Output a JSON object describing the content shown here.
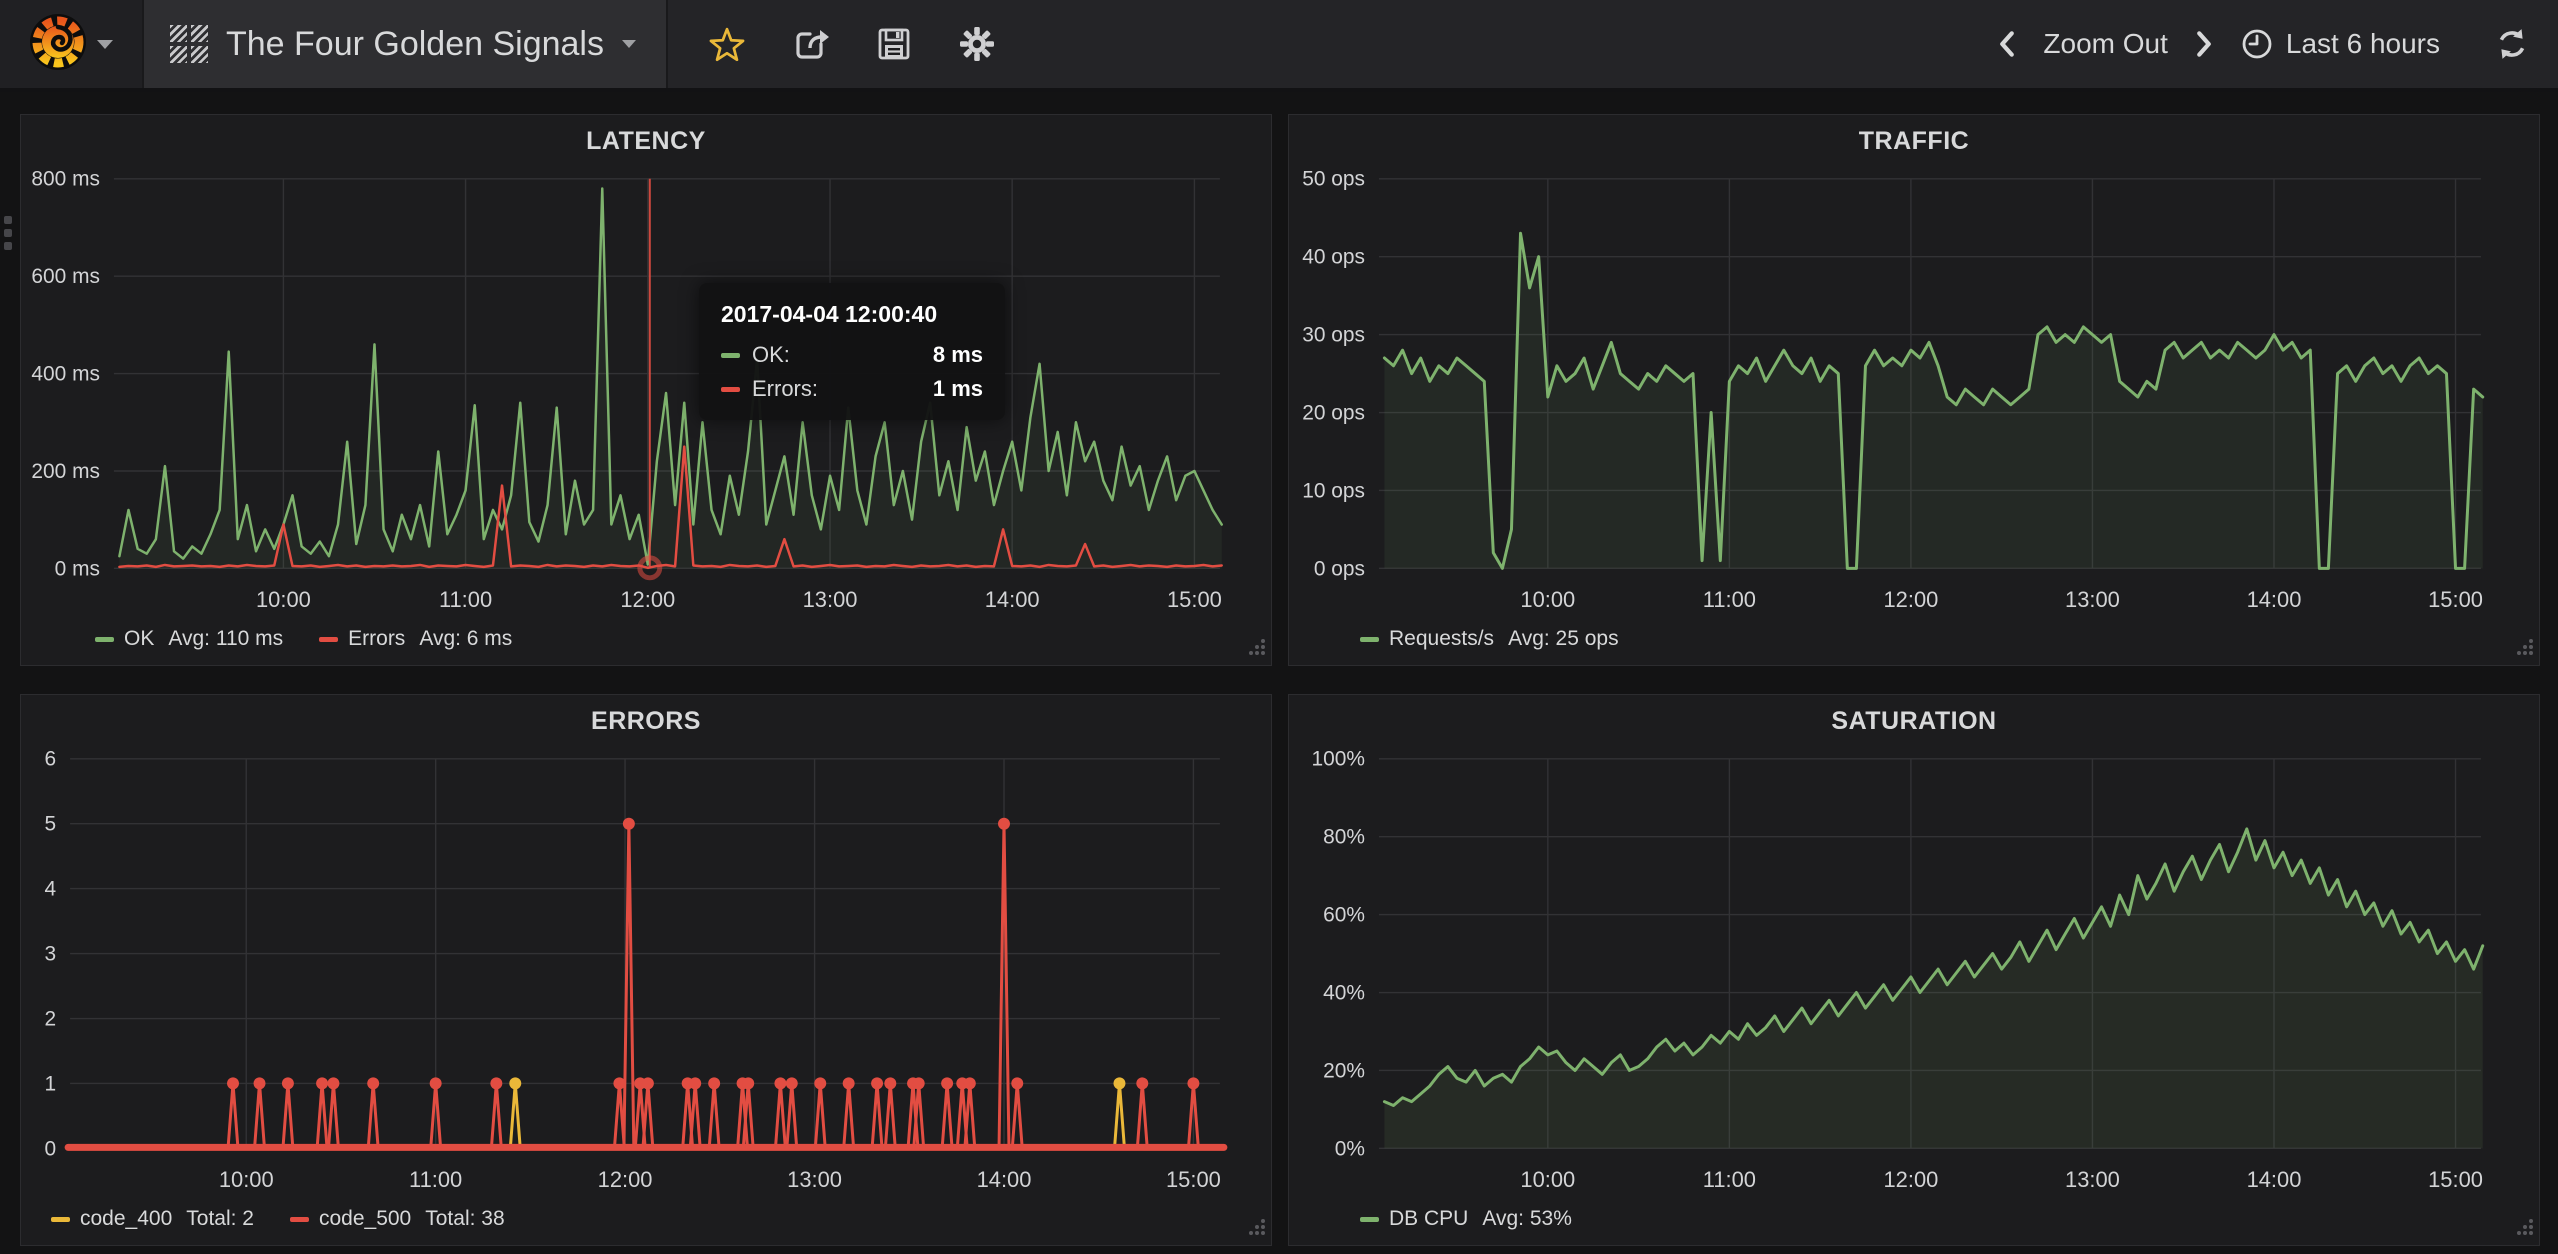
{
  "navbar": {
    "title": "The Four Golden Signals",
    "zoom_out_label": "Zoom Out",
    "time_range_label": "Last 6 hours"
  },
  "colors": {
    "green": "#7eb26d",
    "red": "#e24d42",
    "yellow": "#eab839",
    "star": "#eab839",
    "panel_bg": "#1c1c1e",
    "page_bg": "#131314",
    "navbar_bg": "#242427",
    "gridline": "#323235",
    "text": "#d8d9da"
  },
  "chart_data": [
    {
      "id": "latency",
      "type": "line",
      "title": "LATENCY",
      "xlabel": "",
      "ylabel": "",
      "xlim": [
        9.07,
        15.14
      ],
      "ylim": [
        0,
        800
      ],
      "grid": true,
      "legend_position": "bottom-left",
      "xticks": {
        "values": [
          10,
          11,
          12,
          13,
          14,
          15
        ],
        "labels": [
          "10:00",
          "11:00",
          "12:00",
          "13:00",
          "14:00",
          "15:00"
        ]
      },
      "yticks": {
        "values": [
          0,
          200,
          400,
          600,
          800
        ],
        "labels": [
          "0 ms",
          "200 ms",
          "400 ms",
          "600 ms",
          "800 ms"
        ]
      },
      "series": [
        {
          "name": "OK",
          "color": "#7eb26d",
          "width": 2.5,
          "fill": 0.08,
          "t0": 9.1,
          "dt": 0.05,
          "values": [
            25,
            120,
            40,
            30,
            60,
            210,
            35,
            20,
            45,
            30,
            70,
            120,
            445,
            60,
            130,
            35,
            80,
            40,
            90,
            150,
            45,
            30,
            55,
            25,
            90,
            260,
            50,
            130,
            460,
            80,
            35,
            110,
            60,
            130,
            45,
            240,
            70,
            110,
            160,
            335,
            60,
            120,
            80,
            150,
            340,
            95,
            55,
            130,
            330,
            70,
            180,
            90,
            120,
            780,
            90,
            150,
            60,
            110,
            8,
            220,
            360,
            130,
            340,
            90,
            300,
            120,
            70,
            190,
            110,
            240,
            430,
            90,
            160,
            230,
            110,
            300,
            150,
            80,
            190,
            120,
            330,
            160,
            90,
            230,
            300,
            130,
            200,
            100,
            260,
            340,
            150,
            220,
            120,
            290,
            180,
            240,
            130,
            200,
            260,
            160,
            310,
            420,
            200,
            280,
            150,
            300,
            220,
            260,
            180,
            140,
            250,
            170,
            210,
            120,
            180,
            230,
            140,
            190,
            200,
            160,
            120,
            90
          ]
        },
        {
          "name": "Errors",
          "color": "#e24d42",
          "width": 2.5,
          "fill": 0,
          "t0": 9.1,
          "dt": 0.05,
          "values": [
            3,
            5,
            4,
            6,
            3,
            7,
            4,
            5,
            6,
            4,
            5,
            3,
            6,
            4,
            7,
            5,
            4,
            6,
            90,
            5,
            4,
            6,
            3,
            5,
            7,
            4,
            6,
            3,
            5,
            4,
            6,
            4,
            5,
            7,
            3,
            6,
            5,
            4,
            7,
            5,
            3,
            6,
            170,
            4,
            6,
            5,
            3,
            7,
            4,
            6,
            5,
            3,
            6,
            4,
            7,
            5,
            4,
            6,
            1,
            5,
            7,
            4,
            250,
            6,
            4,
            5,
            3,
            7,
            5,
            4,
            6,
            3,
            5,
            60,
            4,
            6,
            3,
            5,
            7,
            4,
            5,
            6,
            3,
            5,
            4,
            7,
            5,
            3,
            6,
            4,
            5,
            7,
            4,
            6,
            3,
            5,
            4,
            80,
            5,
            4,
            6,
            3,
            7,
            5,
            4,
            6,
            50,
            4,
            6,
            3,
            5,
            7,
            4,
            6,
            5,
            3,
            6,
            4,
            5,
            7,
            4,
            6
          ]
        }
      ],
      "legend": [
        {
          "name": "OK",
          "stat": "Avg: 110 ms",
          "color": "#7eb26d"
        },
        {
          "name": "Errors",
          "stat": "Avg: 6 ms",
          "color": "#e24d42"
        }
      ],
      "crosshair": {
        "time": 12.011,
        "marker_value": 1,
        "color": "#e24d42"
      },
      "tooltip": {
        "time": "2017-04-04 12:00:40",
        "rows": [
          {
            "label": "OK:",
            "value": "8 ms",
            "color": "#7eb26d"
          },
          {
            "label": "Errors:",
            "value": "1 ms",
            "color": "#e24d42"
          }
        ]
      }
    },
    {
      "id": "traffic",
      "type": "line",
      "title": "TRAFFIC",
      "xlabel": "",
      "ylabel": "",
      "xlim": [
        9.07,
        15.14
      ],
      "ylim": [
        0,
        50
      ],
      "grid": true,
      "legend_position": "bottom-left",
      "xticks": {
        "values": [
          10,
          11,
          12,
          13,
          14,
          15
        ],
        "labels": [
          "10:00",
          "11:00",
          "12:00",
          "13:00",
          "14:00",
          "15:00"
        ]
      },
      "yticks": {
        "values": [
          0,
          10,
          20,
          30,
          40,
          50
        ],
        "labels": [
          "0 ops",
          "10 ops",
          "20 ops",
          "30 ops",
          "40 ops",
          "50 ops"
        ]
      },
      "series": [
        {
          "name": "Requests/s",
          "color": "#7eb26d",
          "width": 3,
          "fill": 0.09,
          "t0": 9.1,
          "dt": 0.05,
          "values": [
            27,
            26,
            28,
            25,
            27,
            24,
            26,
            25,
            27,
            26,
            25,
            24,
            2,
            0,
            5,
            43,
            36,
            40,
            22,
            26,
            24,
            25,
            27,
            23,
            26,
            29,
            25,
            24,
            23,
            25,
            24,
            26,
            25,
            24,
            25,
            1,
            20,
            1,
            24,
            26,
            25,
            27,
            24,
            26,
            28,
            26,
            25,
            27,
            24,
            26,
            25,
            0,
            0,
            26,
            28,
            26,
            27,
            26,
            28,
            27,
            29,
            26,
            22,
            21,
            23,
            22,
            21,
            23,
            22,
            21,
            22,
            23,
            30,
            31,
            29,
            30,
            29,
            31,
            30,
            29,
            30,
            24,
            23,
            22,
            24,
            23,
            28,
            29,
            27,
            28,
            29,
            27,
            28,
            27,
            29,
            28,
            27,
            28,
            30,
            28,
            29,
            27,
            28,
            0,
            0,
            25,
            26,
            24,
            26,
            27,
            25,
            26,
            24,
            26,
            27,
            25,
            26,
            25,
            0,
            0,
            23,
            22
          ]
        }
      ],
      "legend": [
        {
          "name": "Requests/s",
          "stat": "Avg: 25 ops",
          "color": "#7eb26d"
        }
      ]
    },
    {
      "id": "errors",
      "type": "spikes",
      "title": "ERRORS",
      "xlabel": "",
      "ylabel": "",
      "xlim": [
        9.07,
        15.14
      ],
      "ylim": [
        0,
        6
      ],
      "grid": true,
      "legend_position": "bottom-left",
      "xticks": {
        "values": [
          10,
          11,
          12,
          13,
          14,
          15
        ],
        "labels": [
          "10:00",
          "11:00",
          "12:00",
          "13:00",
          "14:00",
          "15:00"
        ]
      },
      "yticks": {
        "values": [
          0,
          1,
          2,
          3,
          4,
          5,
          6
        ],
        "labels": [
          "0",
          "1",
          "2",
          "3",
          "4",
          "5",
          "6"
        ]
      },
      "series": [
        {
          "name": "code_400",
          "color": "#eab839",
          "width": 3,
          "baseline": false,
          "spikes": [
            [
              11.42,
              1
            ],
            [
              14.61,
              1
            ]
          ]
        },
        {
          "name": "code_500",
          "color": "#e24d42",
          "width": 3,
          "baseline": true,
          "baseline_width": 7,
          "spikes": [
            [
              9.93,
              1
            ],
            [
              10.07,
              1
            ],
            [
              10.22,
              1
            ],
            [
              10.4,
              1
            ],
            [
              10.46,
              1
            ],
            [
              10.67,
              1
            ],
            [
              11.0,
              1
            ],
            [
              11.32,
              1
            ],
            [
              11.97,
              1
            ],
            [
              12.02,
              5
            ],
            [
              12.08,
              1
            ],
            [
              12.12,
              1
            ],
            [
              12.33,
              1
            ],
            [
              12.37,
              1
            ],
            [
              12.47,
              1
            ],
            [
              12.62,
              1
            ],
            [
              12.65,
              1
            ],
            [
              12.82,
              1
            ],
            [
              12.88,
              1
            ],
            [
              13.03,
              1
            ],
            [
              13.18,
              1
            ],
            [
              13.33,
              1
            ],
            [
              13.4,
              1
            ],
            [
              13.52,
              1
            ],
            [
              13.55,
              1
            ],
            [
              13.7,
              1
            ],
            [
              13.78,
              1
            ],
            [
              13.82,
              1
            ],
            [
              14.0,
              5
            ],
            [
              14.07,
              1
            ],
            [
              14.73,
              1
            ],
            [
              15.0,
              1
            ]
          ]
        }
      ],
      "legend": [
        {
          "name": "code_400",
          "stat": "Total: 2",
          "color": "#eab839"
        },
        {
          "name": "code_500",
          "stat": "Total: 38",
          "color": "#e24d42"
        }
      ]
    },
    {
      "id": "saturation",
      "type": "line",
      "title": "SATURATION",
      "xlabel": "",
      "ylabel": "",
      "xlim": [
        9.07,
        15.14
      ],
      "ylim": [
        0,
        100
      ],
      "grid": true,
      "legend_position": "bottom-left",
      "xticks": {
        "values": [
          10,
          11,
          12,
          13,
          14,
          15
        ],
        "labels": [
          "10:00",
          "11:00",
          "12:00",
          "13:00",
          "14:00",
          "15:00"
        ]
      },
      "yticks": {
        "values": [
          0,
          20,
          40,
          60,
          80,
          100
        ],
        "labels": [
          "0%",
          "20%",
          "40%",
          "60%",
          "80%",
          "100%"
        ]
      },
      "series": [
        {
          "name": "DB CPU",
          "color": "#7eb26d",
          "width": 3,
          "fill": 0.1,
          "t0": 9.1,
          "dt": 0.05,
          "values": [
            12,
            11,
            13,
            12,
            14,
            16,
            19,
            21,
            18,
            17,
            20,
            16,
            18,
            19,
            17,
            21,
            23,
            26,
            24,
            25,
            22,
            20,
            23,
            21,
            19,
            22,
            24,
            20,
            21,
            23,
            26,
            28,
            25,
            27,
            24,
            26,
            29,
            27,
            30,
            28,
            32,
            29,
            31,
            34,
            30,
            33,
            36,
            32,
            35,
            38,
            34,
            37,
            40,
            36,
            39,
            42,
            38,
            41,
            44,
            40,
            43,
            46,
            42,
            45,
            48,
            44,
            47,
            50,
            46,
            49,
            53,
            48,
            52,
            56,
            51,
            55,
            59,
            54,
            58,
            62,
            57,
            65,
            60,
            70,
            64,
            68,
            73,
            66,
            71,
            75,
            69,
            74,
            78,
            71,
            76,
            82,
            74,
            79,
            72,
            76,
            70,
            74,
            68,
            72,
            65,
            69,
            62,
            66,
            60,
            63,
            57,
            61,
            55,
            58,
            53,
            56,
            50,
            53,
            48,
            51,
            46,
            52
          ]
        }
      ],
      "legend": [
        {
          "name": "DB CPU",
          "stat": "Avg: 53%",
          "color": "#7eb26d"
        }
      ]
    }
  ]
}
